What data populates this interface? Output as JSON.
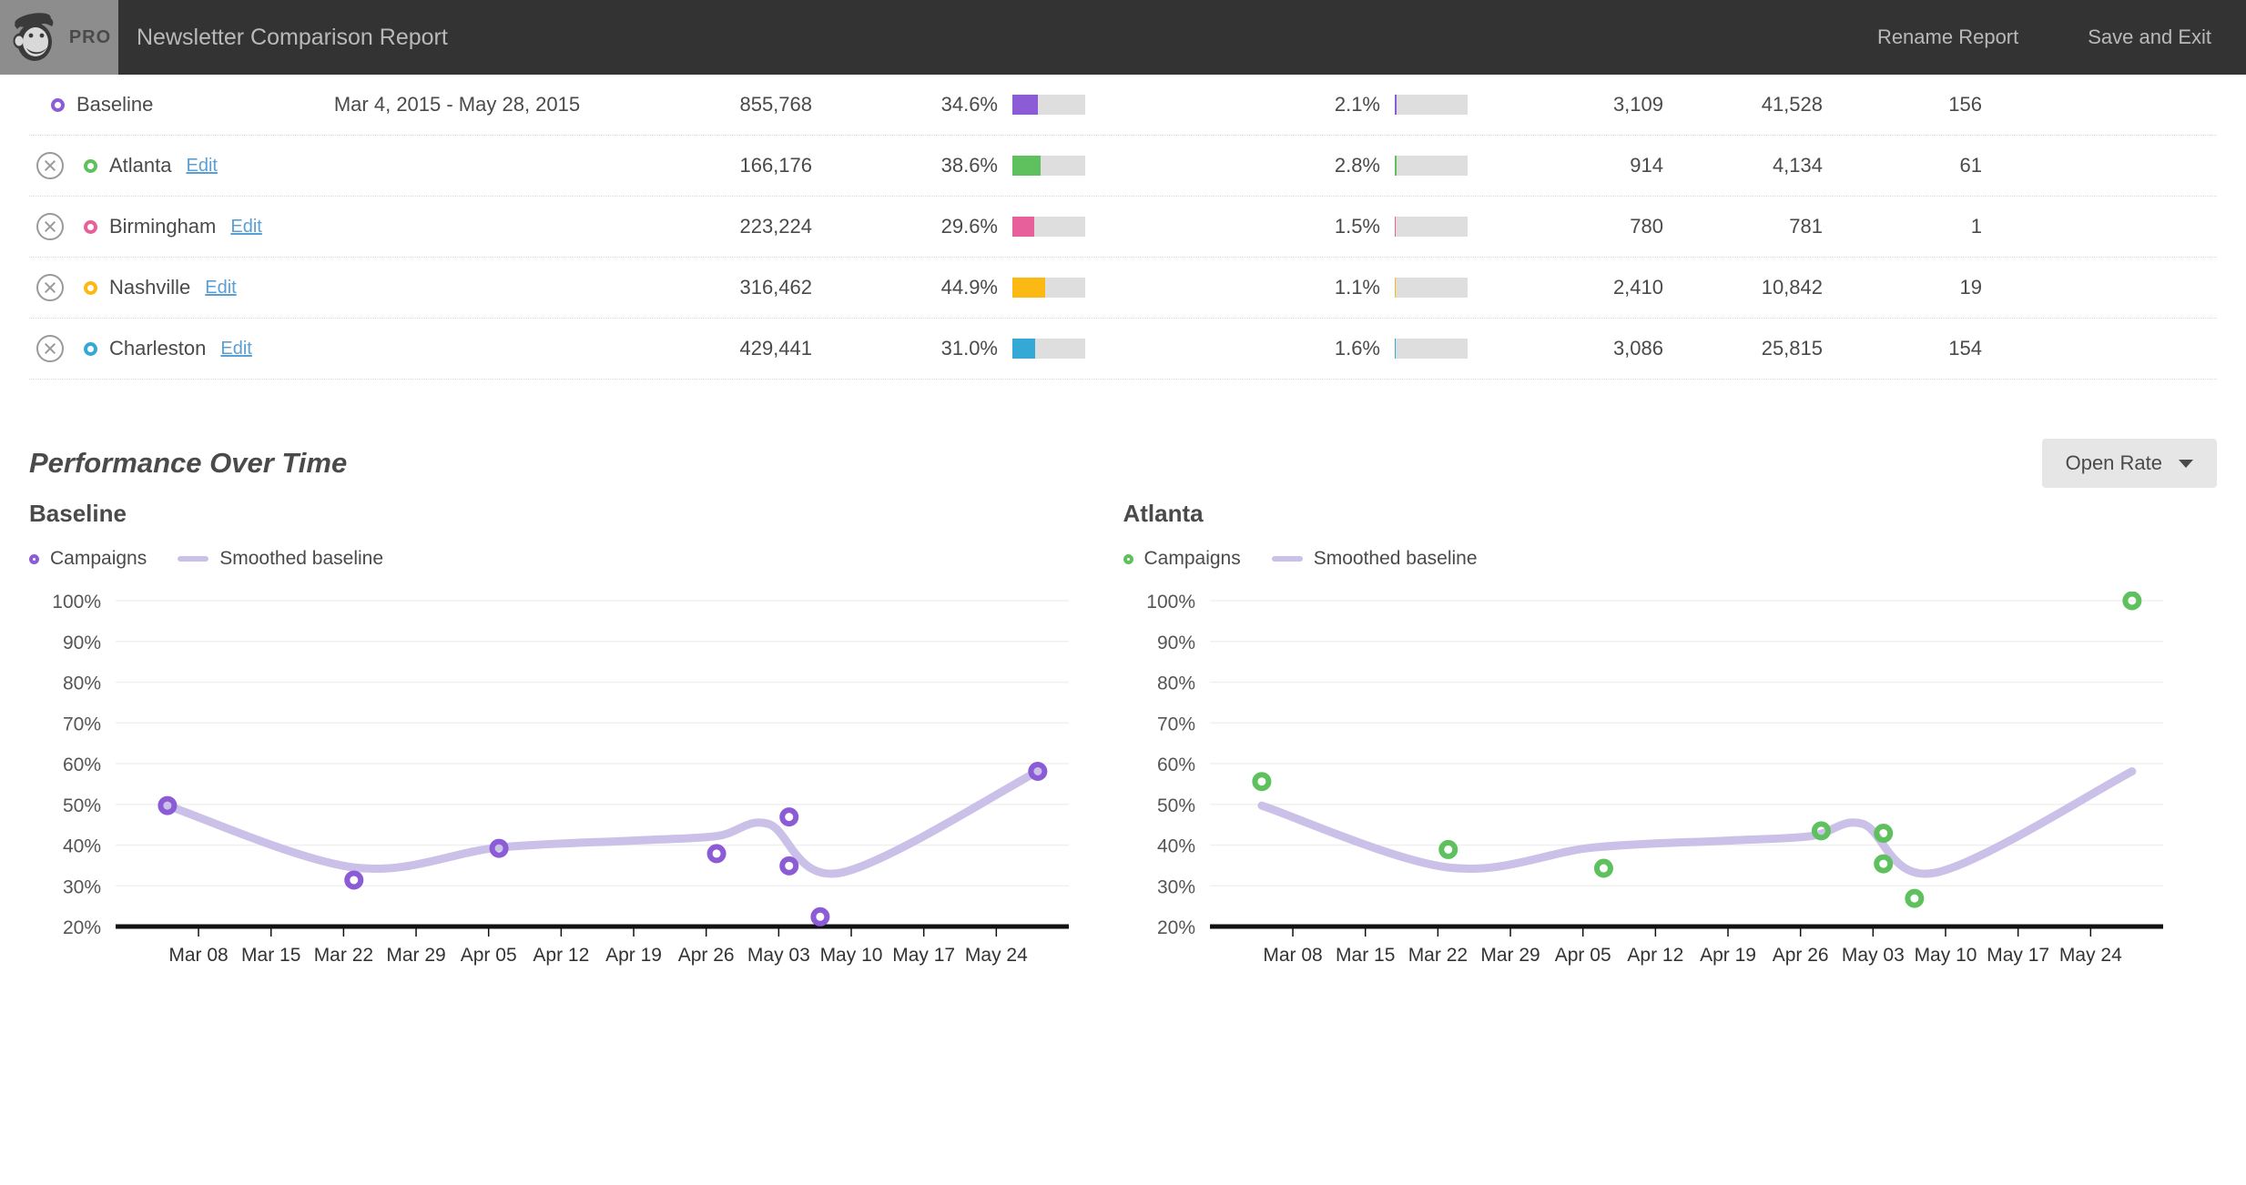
{
  "header": {
    "logo_label": "PRO",
    "logo_icon": "mailchimp-freddie-icon",
    "title": "Newsletter Comparison Report",
    "rename_label": "Rename Report",
    "save_exit_label": "Save and Exit"
  },
  "table": {
    "rows": [
      {
        "name": "Baseline",
        "is_baseline": true,
        "color": "#8b5cd6",
        "dates": "Mar 4, 2015 - May 28, 2015",
        "recipients": "855,768",
        "open_rate": "34.6%",
        "open_rate_value": 34.6,
        "click_rate": "2.1%",
        "click_rate_value": 2.1,
        "opens": "3,109",
        "clicks": "41,528",
        "extra": "156"
      },
      {
        "name": "Atlanta",
        "is_baseline": false,
        "edit_label": "Edit",
        "color": "#5ec15e",
        "dates": "",
        "recipients": "166,176",
        "open_rate": "38.6%",
        "open_rate_value": 38.6,
        "click_rate": "2.8%",
        "click_rate_value": 2.8,
        "opens": "914",
        "clicks": "4,134",
        "extra": "61"
      },
      {
        "name": "Birmingham",
        "is_baseline": false,
        "edit_label": "Edit",
        "color": "#e8609b",
        "dates": "",
        "recipients": "223,224",
        "open_rate": "29.6%",
        "open_rate_value": 29.6,
        "click_rate": "1.5%",
        "click_rate_value": 1.5,
        "opens": "780",
        "clicks": "781",
        "extra": "1"
      },
      {
        "name": "Nashville",
        "is_baseline": false,
        "edit_label": "Edit",
        "color": "#fdb913",
        "dates": "",
        "recipients": "316,462",
        "open_rate": "44.9%",
        "open_rate_value": 44.9,
        "click_rate": "1.1%",
        "click_rate_value": 1.1,
        "opens": "2,410",
        "clicks": "10,842",
        "extra": "19"
      },
      {
        "name": "Charleston",
        "is_baseline": false,
        "edit_label": "Edit",
        "color": "#35a9d6",
        "dates": "",
        "recipients": "429,441",
        "open_rate": "31.0%",
        "open_rate_value": 31.0,
        "click_rate": "1.6%",
        "click_rate_value": 1.6,
        "opens": "3,086",
        "clicks": "25,815",
        "extra": "154"
      }
    ]
  },
  "performance": {
    "section_title": "Performance Over Time",
    "metric_label": "Open Rate",
    "metric_icon": "chevron-down-icon"
  },
  "chart_data": [
    {
      "type": "scatter",
      "title": "Baseline",
      "legend": {
        "points_label": "Campaigns",
        "line_label": "Smoothed baseline",
        "position": "top-left"
      },
      "point_color": "#8b5cd6",
      "line_color": "#cbc0e8",
      "xlabel": "",
      "ylabel": "",
      "ylim": [
        20,
        100
      ],
      "yticks": [
        "20%",
        "30%",
        "40%",
        "50%",
        "60%",
        "70%",
        "80%",
        "90%",
        "100%"
      ],
      "xticks": [
        "Mar 08",
        "Mar 15",
        "Mar 22",
        "Mar 29",
        "Apr 05",
        "Apr 12",
        "Apr 19",
        "Apr 26",
        "May 03",
        "May 10",
        "May 17",
        "May 24"
      ],
      "grid": true,
      "points": [
        {
          "x": "Mar 05",
          "y": 49.7
        },
        {
          "x": "Mar 23",
          "y": 31.4
        },
        {
          "x": "Apr 06",
          "y": 39.2
        },
        {
          "x": "Apr 27",
          "y": 37.9
        },
        {
          "x": "May 04",
          "y": 46.9
        },
        {
          "x": "May 04",
          "y": 34.9
        },
        {
          "x": "May 07",
          "y": 22.4
        },
        {
          "x": "May 28",
          "y": 58.1
        }
      ],
      "smoothed_line": [
        {
          "x": "Mar 05",
          "y": 49.7
        },
        {
          "x": "Mar 23",
          "y": 34.5
        },
        {
          "x": "Apr 06",
          "y": 39.4
        },
        {
          "x": "Apr 19",
          "y": 41.1
        },
        {
          "x": "Apr 27",
          "y": 42.2
        },
        {
          "x": "May 02",
          "y": 45.2
        },
        {
          "x": "May 09",
          "y": 33.2
        },
        {
          "x": "May 28",
          "y": 58.1
        }
      ]
    },
    {
      "type": "scatter",
      "title": "Atlanta",
      "legend": {
        "points_label": "Campaigns",
        "line_label": "Smoothed baseline",
        "position": "top-left"
      },
      "point_color": "#5ec15e",
      "line_color": "#cbc0e8",
      "xlabel": "",
      "ylabel": "",
      "ylim": [
        20,
        100
      ],
      "yticks": [
        "20%",
        "30%",
        "40%",
        "50%",
        "60%",
        "70%",
        "80%",
        "90%",
        "100%"
      ],
      "xticks": [
        "Mar 08",
        "Mar 15",
        "Mar 22",
        "Mar 29",
        "Apr 05",
        "Apr 12",
        "Apr 19",
        "Apr 26",
        "May 03",
        "May 10",
        "May 17",
        "May 24"
      ],
      "grid": true,
      "points": [
        {
          "x": "Mar 05",
          "y": 55.6
        },
        {
          "x": "Mar 23",
          "y": 38.9
        },
        {
          "x": "Apr 07",
          "y": 34.3
        },
        {
          "x": "Apr 28",
          "y": 43.5
        },
        {
          "x": "May 04",
          "y": 42.9
        },
        {
          "x": "May 04",
          "y": 35.4
        },
        {
          "x": "May 07",
          "y": 26.9
        },
        {
          "x": "May 28",
          "y": 100.0
        }
      ],
      "smoothed_line": [
        {
          "x": "Mar 05",
          "y": 49.7
        },
        {
          "x": "Mar 23",
          "y": 34.5
        },
        {
          "x": "Apr 06",
          "y": 39.4
        },
        {
          "x": "Apr 19",
          "y": 41.1
        },
        {
          "x": "Apr 27",
          "y": 42.2
        },
        {
          "x": "May 02",
          "y": 45.2
        },
        {
          "x": "May 09",
          "y": 33.2
        },
        {
          "x": "May 28",
          "y": 58.1
        }
      ]
    }
  ]
}
